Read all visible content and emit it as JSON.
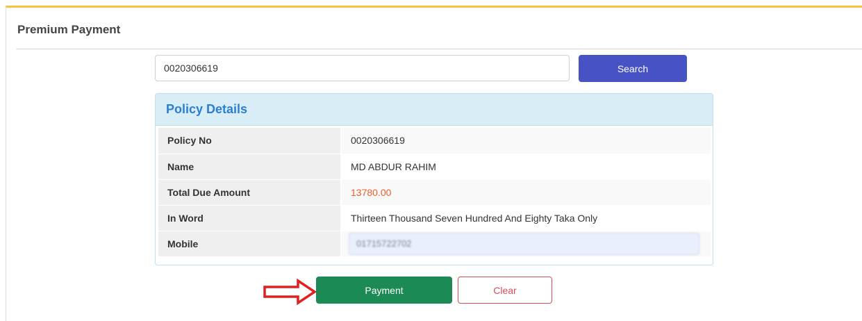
{
  "page": {
    "title": "Premium Payment"
  },
  "search": {
    "value": "0020306619",
    "button_label": "Search"
  },
  "policy_details": {
    "heading": "Policy Details",
    "rows": [
      {
        "label": "Policy No",
        "value": "0020306619"
      },
      {
        "label": "Name",
        "value": "MD ABDUR RAHIM"
      },
      {
        "label": "Total Due Amount",
        "value": "13780.00"
      },
      {
        "label": "In Word",
        "value": "Thirteen Thousand Seven Hundred And Eighty Taka Only"
      },
      {
        "label": "Mobile",
        "value": "01715722702"
      }
    ]
  },
  "actions": {
    "payment_label": "Payment",
    "clear_label": "Clear"
  },
  "colors": {
    "accent_top": "#f5c242",
    "search_button": "#4752c4",
    "payment_button": "#1c8a55",
    "clear_button": "#d84a5a",
    "due_amount": "#e8612c",
    "arrow": "#e02020"
  },
  "icons": {
    "annotation": "right-arrow-icon"
  }
}
